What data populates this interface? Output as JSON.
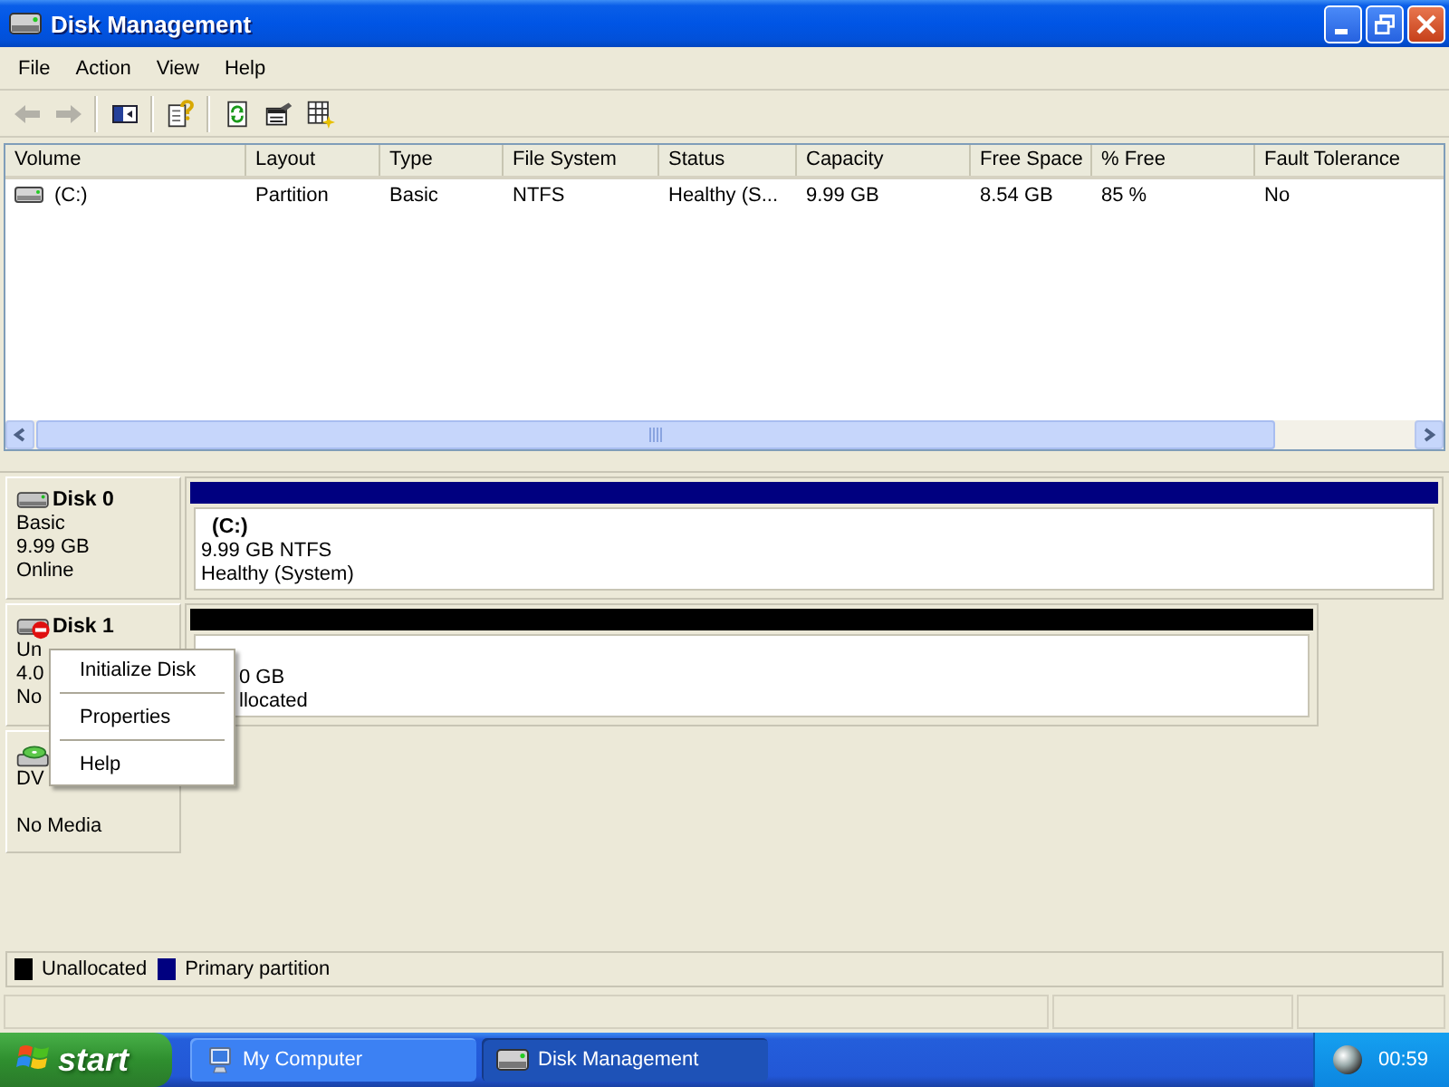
{
  "window": {
    "title": "Disk Management",
    "maximized": true
  },
  "menu_bar": [
    "File",
    "Action",
    "View",
    "Help"
  ],
  "toolbar": {
    "groups": [
      {
        "buttons": [
          {
            "kind": "back",
            "disabled": true
          },
          {
            "kind": "forward",
            "disabled": true
          }
        ]
      },
      {
        "buttons": [
          {
            "kind": "tree",
            "disabled": false
          }
        ]
      },
      {
        "buttons": [
          {
            "kind": "help",
            "disabled": false
          }
        ]
      },
      {
        "buttons": [
          {
            "kind": "refresh",
            "disabled": false
          },
          {
            "kind": "properties",
            "disabled": false
          },
          {
            "kind": "export",
            "disabled": false
          }
        ]
      }
    ]
  },
  "volume_table": {
    "columns": [
      "Volume",
      "Layout",
      "Type",
      "File System",
      "Status",
      "Capacity",
      "Free Space",
      "% Free",
      "Fault Tolerance"
    ],
    "rows": [
      {
        "cells": [
          "(C:)",
          "Partition",
          "Basic",
          "NTFS",
          "Healthy (S...",
          "9.99 GB",
          "8.54 GB",
          "85 %",
          "No"
        ]
      }
    ]
  },
  "disks": [
    {
      "kind": "disk",
      "name": "Disk 0",
      "not_initialized": false,
      "details": [
        "Basic",
        "9.99 GB",
        "Online"
      ],
      "partitions": [
        {
          "color": "#000080",
          "label": "(C:)",
          "details": [
            "9.99 GB NTFS",
            "Healthy (System)"
          ]
        }
      ]
    },
    {
      "kind": "disk",
      "name": "Disk 1",
      "not_initialized": true,
      "details": [
        "Un",
        "4.0",
        "No"
      ],
      "partitions": [
        {
          "color": "#000000",
          "details": [
            "0 GB",
            "llocated"
          ]
        }
      ]
    },
    {
      "kind": "cdrom",
      "details": [
        "DV",
        "No Media"
      ]
    }
  ],
  "context_menu": {
    "items": [
      "Initialize Disk",
      "Properties",
      "Help"
    ]
  },
  "legend": [
    {
      "label": "Unallocated",
      "color": "#000000"
    },
    {
      "label": "Primary partition",
      "color": "#000080"
    }
  ],
  "taskbar": {
    "start": "start",
    "buttons": [
      {
        "kind": "computer",
        "label": "My Computer",
        "selected": false
      },
      {
        "kind": "disk_management",
        "label": "Disk Management",
        "selected": true
      }
    ],
    "clock": "00:59"
  }
}
